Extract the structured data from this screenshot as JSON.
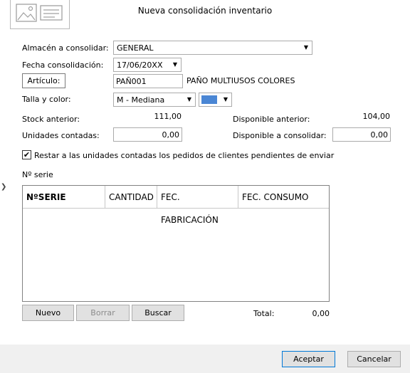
{
  "window": {
    "title": "Nueva consolidación inventario"
  },
  "form": {
    "almacen_label": "Almacén a consolidar:",
    "almacen_value": "GENERAL",
    "fecha_label": "Fecha consolidación:",
    "fecha_value": "17/06/20XX",
    "articulo_button": "Artículo:",
    "articulo_code": "PAÑ001",
    "articulo_desc": "PAÑO MULTIUSOS COLORES",
    "talla_label": "Talla y color:",
    "talla_value": "M - Mediana",
    "color_swatch": "#4a86d4",
    "stock_label": "Stock anterior:",
    "stock_value": "111,00",
    "disp_ant_label": "Disponible anterior:",
    "disp_ant_value": "104,00",
    "unid_label": "Unidades contadas:",
    "unid_value": "0,00",
    "disp_cons_label": "Disponible a consolidar:",
    "disp_cons_value": "0,00",
    "restar_checked": true,
    "restar_label": "Restar a las unidades contadas los pedidos de clientes pendientes de enviar",
    "serie_label": "Nº serie"
  },
  "grid": {
    "columns": [
      "NºSERIE",
      "CANTIDAD",
      "FEC. FABRICACIÓN",
      "FEC. CONSUMO"
    ],
    "rows": []
  },
  "grid_buttons": {
    "nuevo": "Nuevo",
    "borrar": "Borrar",
    "buscar": "Buscar"
  },
  "total": {
    "label": "Total:",
    "value": "0,00"
  },
  "footer": {
    "accept": "Aceptar",
    "cancel": "Cancelar"
  },
  "icons": {
    "chevron": "chevron-right-icon",
    "logo": "image-document-icon",
    "dropdown": "chevron-down-icon"
  }
}
